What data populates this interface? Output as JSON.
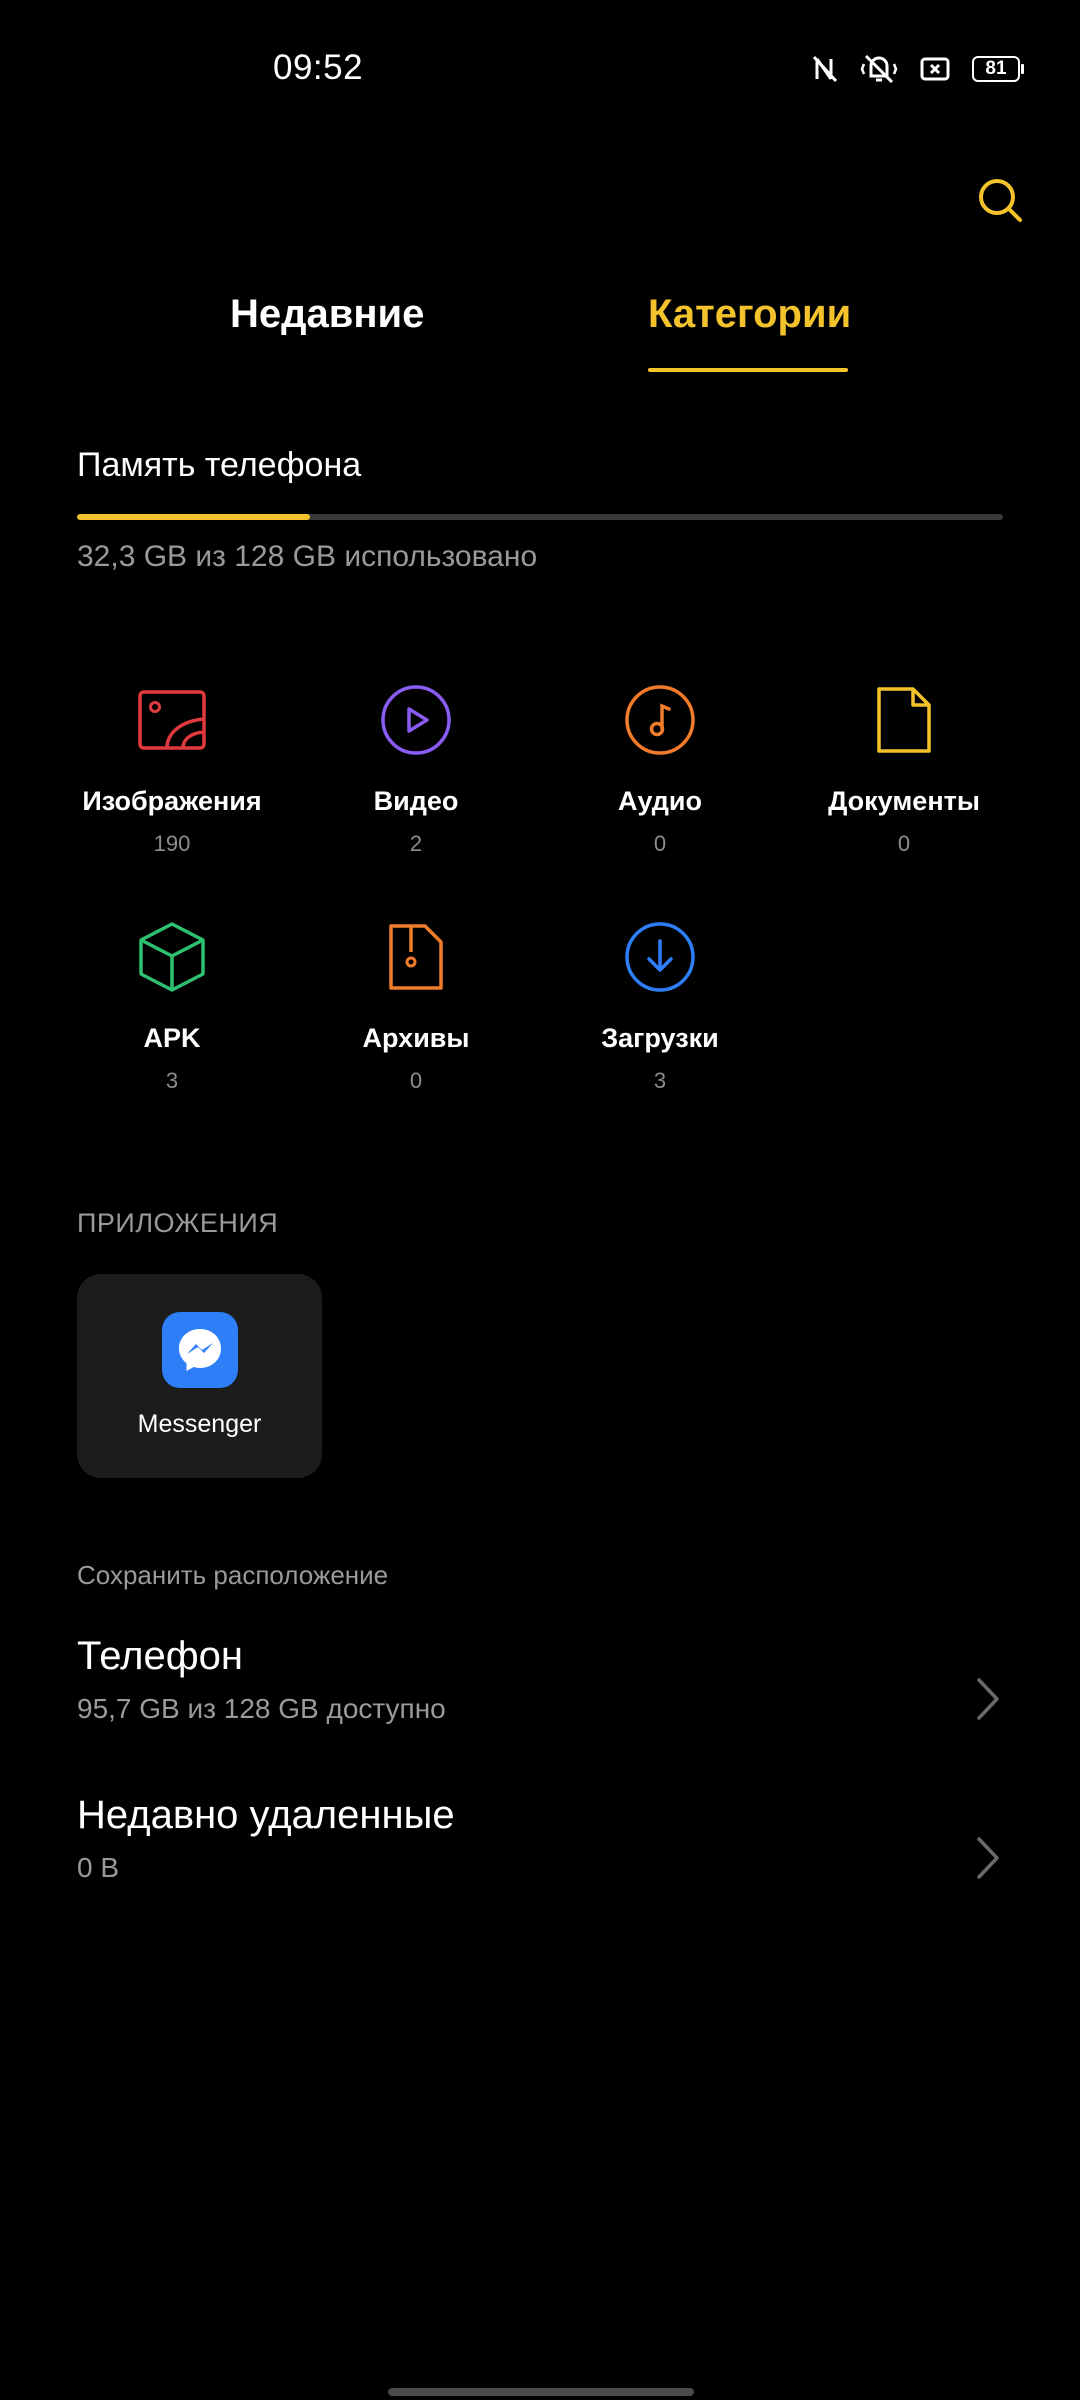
{
  "status": {
    "time": "09:52",
    "battery": "81",
    "icons": [
      "nfc-off-icon",
      "vibrate-off-icon",
      "cast-icon",
      "battery-icon"
    ]
  },
  "header": {
    "search_icon": "search-icon",
    "tabs": [
      {
        "label": "Недавние",
        "active": false
      },
      {
        "label": "Категории",
        "active": true
      }
    ],
    "accent_color": "#f4c22b"
  },
  "storage": {
    "title": "Память телефона",
    "summary": "32,3 GB из 128 GB использовано",
    "used_fraction": 0.252
  },
  "categories": [
    {
      "label": "Изображения",
      "count": "190",
      "icon": "image-icon",
      "color": "#e0393e"
    },
    {
      "label": "Видео",
      "count": "2",
      "icon": "play-icon",
      "color": "#8a5cf6"
    },
    {
      "label": "Аудио",
      "count": "0",
      "icon": "music-icon",
      "color": "#f07c2b"
    },
    {
      "label": "Документы",
      "count": "0",
      "icon": "document-icon",
      "color": "#f4c22b"
    },
    {
      "label": "APK",
      "count": "3",
      "icon": "package-icon",
      "color": "#2fbf71"
    },
    {
      "label": "Архивы",
      "count": "0",
      "icon": "archive-icon",
      "color": "#f07c2b"
    },
    {
      "label": "Загрузки",
      "count": "3",
      "icon": "download-icon",
      "color": "#2d7ef7"
    }
  ],
  "apps": {
    "title": "ПРИЛОЖЕНИЯ",
    "items": [
      {
        "name": "Messenger",
        "icon": "messenger-icon",
        "color": "#2d7ef7"
      }
    ]
  },
  "save_location": {
    "title": "Сохранить расположение",
    "items": [
      {
        "title": "Телефон",
        "subtitle": "95,7 GB из 128 GB доступно"
      },
      {
        "title": "Недавно удаленные",
        "subtitle": "0 B"
      }
    ]
  }
}
